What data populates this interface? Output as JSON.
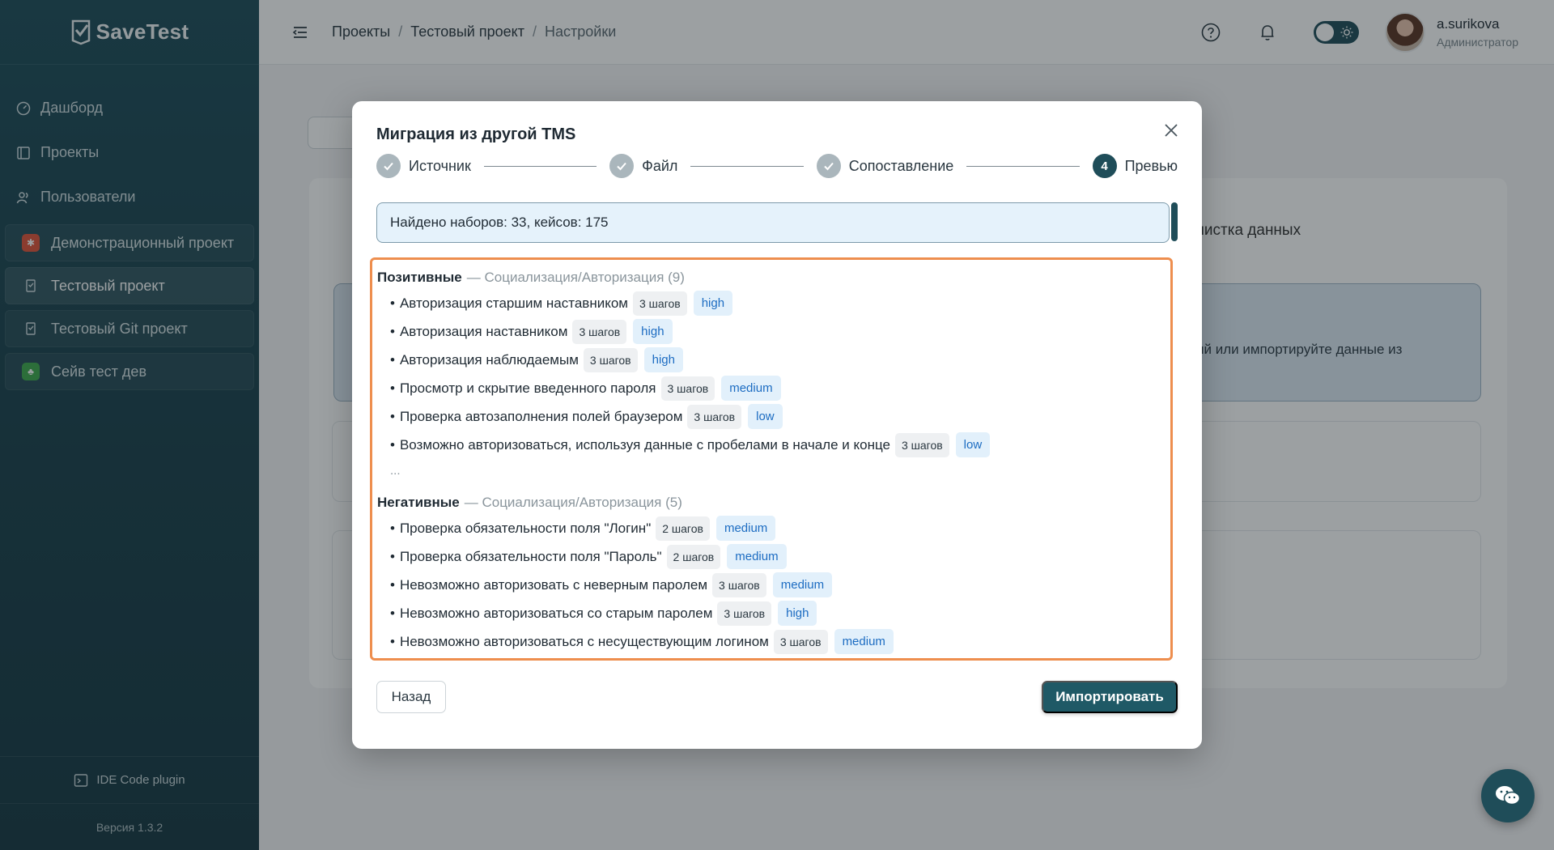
{
  "sidebar": {
    "logo": "SaveTest",
    "nav": [
      {
        "label": "Дашборд",
        "icon": "dashboard-icon"
      },
      {
        "label": "Проекты",
        "icon": "projects-icon"
      },
      {
        "label": "Пользователи",
        "icon": "users-icon"
      }
    ],
    "projects": [
      {
        "label": "Демонстрационный проект",
        "icon": "bug-icon",
        "color": "#e0533a"
      },
      {
        "label": "Тестовый проект",
        "icon": "project-file-icon",
        "color": "transparent"
      },
      {
        "label": "Тестовый Git проект",
        "icon": "project-file-icon",
        "color": "transparent"
      },
      {
        "label": "Сейв тест дев",
        "icon": "leaf-icon",
        "color": "#3fa94c"
      }
    ],
    "plugin": "IDE Code plugin",
    "version": "Версия 1.3.2"
  },
  "header": {
    "breadcrumbs": [
      "Проекты",
      "Тестовый проект",
      "Настройки"
    ],
    "separator": "/",
    "user": {
      "name": "a.surikova",
      "role": "Администратор"
    }
  },
  "background": {
    "tab_partial": "чистка данных",
    "info_partial": "ий или импортируйте данные из"
  },
  "modal": {
    "title": "Миграция из другой TMS",
    "steps": [
      {
        "label": "Источник",
        "state": "done"
      },
      {
        "label": "Файл",
        "state": "done"
      },
      {
        "label": "Сопоставление",
        "state": "done"
      },
      {
        "label": "Превью",
        "state": "current",
        "number": "4"
      }
    ],
    "found": "Найдено наборов: 33, кейсов: 175",
    "sections": [
      {
        "title": "Позитивные",
        "path": "— Социализация/Авторизация (9)",
        "cases": [
          {
            "name": "Авторизация старшим наставником",
            "steps": "3 шагов",
            "priority": "high"
          },
          {
            "name": "Авторизация наставником",
            "steps": "3 шагов",
            "priority": "high"
          },
          {
            "name": "Авторизация наблюдаемым",
            "steps": "3 шагов",
            "priority": "high"
          },
          {
            "name": "Просмотр и скрытие введенного пароля",
            "steps": "3 шагов",
            "priority": "medium"
          },
          {
            "name": "Проверка автозаполнения полей браузером",
            "steps": "3 шагов",
            "priority": "low"
          },
          {
            "name": "Возможно авторизоваться, используя данные с пробелами в начале и конце",
            "steps": "3 шагов",
            "priority": "low"
          }
        ],
        "more": "..."
      },
      {
        "title": "Негативные",
        "path": "— Социализация/Авторизация (5)",
        "cases": [
          {
            "name": "Проверка обязательности поля \"Логин\"",
            "steps": "2 шагов",
            "priority": "medium"
          },
          {
            "name": "Проверка обязательности поля \"Пароль\"",
            "steps": "2 шагов",
            "priority": "medium"
          },
          {
            "name": "Невозможно авторизовать с неверным паролем",
            "steps": "3 шагов",
            "priority": "medium"
          },
          {
            "name": "Невозможно авторизоваться со старым паролем",
            "steps": "3 шагов",
            "priority": "high"
          },
          {
            "name": "Невозможно авторизоваться с несуществующим логином",
            "steps": "3 шагов",
            "priority": "medium"
          }
        ]
      }
    ],
    "back_label": "Назад",
    "import_label": "Импортировать"
  },
  "colors": {
    "brand": "#1f4d59",
    "accent_highlight": "#ee8e4e",
    "priority_text": "#1c6cc2"
  }
}
